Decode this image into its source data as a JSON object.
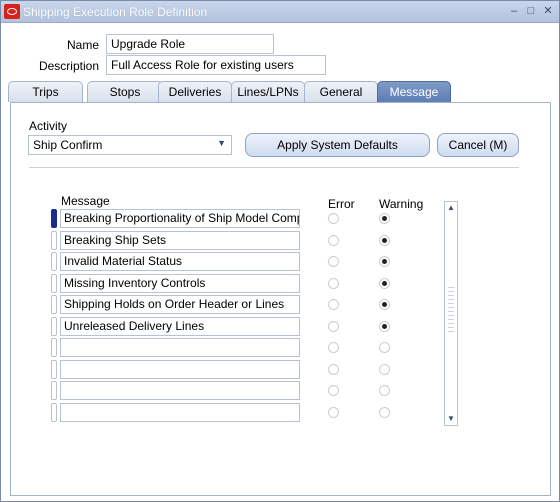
{
  "window": {
    "title": "Shipping Execution Role Definition"
  },
  "form": {
    "name_label": "Name",
    "name_value": "Upgrade Role",
    "description_label": "Description",
    "description_value": "Full Access Role for existing users"
  },
  "tabs": [
    {
      "label": "Trips"
    },
    {
      "label": "Stops"
    },
    {
      "label": "Deliveries"
    },
    {
      "label": "Lines/LPNs"
    },
    {
      "label": "General"
    },
    {
      "label": "Message",
      "active": true
    }
  ],
  "message_tab": {
    "activity_label": "Activity",
    "activity_value": "Ship Confirm",
    "apply_button": "Apply System Defaults",
    "cancel_button": "Cancel (M)",
    "columns": {
      "message": "Message",
      "error": "Error",
      "warning": "Warning"
    },
    "rows": [
      {
        "message": "Breaking Proportionality of Ship Model Compl",
        "selected": "warning",
        "current": true
      },
      {
        "message": "Breaking Ship Sets",
        "selected": "warning"
      },
      {
        "message": "Invalid Material Status",
        "selected": "warning"
      },
      {
        "message": "Missing Inventory Controls",
        "selected": "warning"
      },
      {
        "message": "Shipping Holds on Order Header or Lines",
        "selected": "warning"
      },
      {
        "message": "Unreleased Delivery Lines",
        "selected": "warning"
      },
      {
        "message": "",
        "selected": "none"
      },
      {
        "message": "",
        "selected": "none"
      },
      {
        "message": "",
        "selected": "none"
      },
      {
        "message": "",
        "selected": "none"
      }
    ]
  },
  "icons": {
    "app": "oracle-icon",
    "minimize": "minimize-icon",
    "maximize": "maximize-icon",
    "close": "close-icon",
    "dropdown": "chevron-down-icon",
    "scroll_up": "scroll-up-icon",
    "scroll_down": "scroll-down-icon"
  },
  "colors": {
    "active_tab": "#5b7bb1",
    "titlebar": "#b2c3de",
    "current_row": "#1b2a8c"
  }
}
